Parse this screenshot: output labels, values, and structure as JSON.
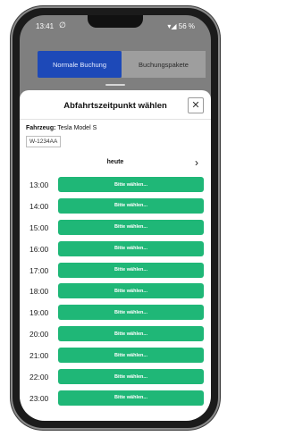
{
  "status_bar": {
    "time": "13:41",
    "left_icon": "∅",
    "right": "▾◢ 56 %"
  },
  "tabs": [
    {
      "label": "Normale Buchung",
      "active": true
    },
    {
      "label": "Buchungspakete",
      "active": false
    }
  ],
  "sheet": {
    "title": "Abfahrtszeitpunkt wählen",
    "close_label": "✕",
    "vehicle_label": "Fahrzeug:",
    "vehicle_name": "Tesla Model S",
    "plate": "W-1234AA",
    "day": "heute",
    "next_label": "›"
  },
  "slot_button_label": "Bitte wählen...",
  "slots": [
    "13:00",
    "14:00",
    "15:00",
    "16:00",
    "17:00",
    "18:00",
    "19:00",
    "20:00",
    "21:00",
    "22:00",
    "23:00"
  ],
  "colors": {
    "accent": "#1d49b8",
    "slot_button": "#1fb777"
  }
}
